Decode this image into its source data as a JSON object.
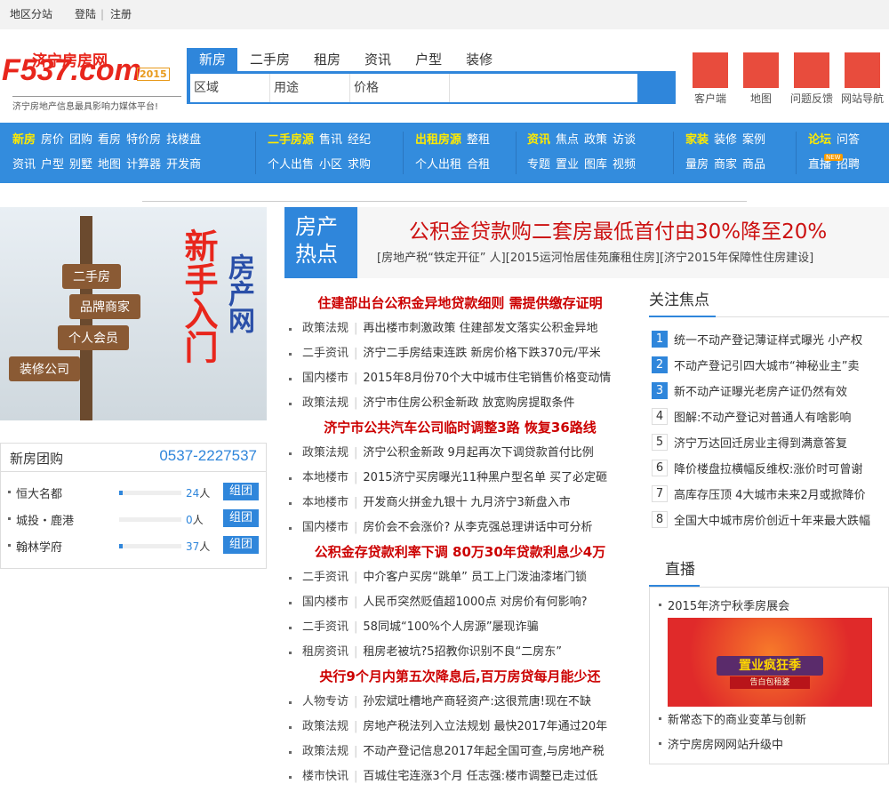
{
  "topbar": {
    "region": "地区分站",
    "login": "登陆",
    "register": "注册"
  },
  "logo": {
    "brand": "F537.com",
    "cn": "济宁房房网",
    "year": "2015",
    "slogan": "济宁房地产信息最具影响力媒体平台!"
  },
  "search": {
    "tabs": [
      "新房",
      "二手房",
      "租房",
      "资讯",
      "户型",
      "装修"
    ],
    "active": 0,
    "filters": [
      "区域",
      "用途",
      "价格"
    ]
  },
  "quick_icons": [
    "客户端",
    "地图",
    "问题反馈",
    "网站导航"
  ],
  "nav": {
    "groups": [
      {
        "rows": [
          [
            "新房",
            "房价",
            "团购",
            "看房",
            "特价房",
            "找楼盘"
          ],
          [
            "资讯",
            "户型",
            "别墅",
            "地图",
            "计算器",
            "开发商"
          ]
        ],
        "hl": [
          [
            0
          ],
          []
        ]
      },
      {
        "rows": [
          [
            "二手房源",
            "售讯",
            "经纪"
          ],
          [
            "个人出售",
            "小区",
            "求购"
          ]
        ],
        "hl": [
          [
            0
          ],
          []
        ]
      },
      {
        "rows": [
          [
            "出租房源",
            "整租"
          ],
          [
            "个人出租",
            "合租"
          ]
        ],
        "hl": [
          [
            0
          ],
          []
        ]
      },
      {
        "rows": [
          [
            "资讯",
            "焦点",
            "政策",
            "访谈"
          ],
          [
            "专题",
            "置业",
            "图库",
            "视频"
          ]
        ],
        "hl": [
          [
            0
          ],
          []
        ]
      },
      {
        "rows": [
          [
            "家装",
            "装修",
            "案例"
          ],
          [
            "量房",
            "商家",
            "商品"
          ]
        ],
        "hl": [
          [
            0
          ],
          []
        ]
      },
      {
        "rows": [
          [
            "论坛",
            "问答"
          ],
          [
            "直播",
            "招聘"
          ]
        ],
        "hl": [
          [
            0
          ],
          []
        ]
      }
    ],
    "new_badge": "NEW"
  },
  "banner": {
    "signs": [
      "二手房",
      "品牌商家",
      "个人会员",
      "装修公司"
    ],
    "title1": "新手入门",
    "title2": "房产网"
  },
  "groupbuy": {
    "title": "新房团购",
    "phone": "0537-2227537",
    "items": [
      {
        "name": "恒大名都",
        "count": "24",
        "unit": "人",
        "progress": 0.03,
        "button": "组团"
      },
      {
        "name": "城投・鹿港",
        "count": "0",
        "unit": "人",
        "progress": 0,
        "button": "组团"
      },
      {
        "name": "翰林学府",
        "count": "37",
        "unit": "人",
        "progress": 0.05,
        "button": "组团"
      }
    ]
  },
  "hot": {
    "label1": "房产",
    "label2": "热点",
    "headline": "公积金贷款购二套房最低首付由30%降至20%",
    "links": "[房地产税“铁定开征” 人][2015运河怡居佳苑廉租住房][济宁2015年保障性住房建设]"
  },
  "news": [
    {
      "headline": "住建部出台公积金异地贷款细则 需提供缴存证明",
      "items": [
        [
          "政策法规",
          "再出楼市刺激政策 住建部发文落实公积金异地"
        ],
        [
          "二手资讯",
          "济宁二手房结束连跌 新房价格下跌370元/平米"
        ],
        [
          "国内楼市",
          "2015年8月份70个大中城市住宅销售价格变动情"
        ],
        [
          "政策法规",
          "济宁市住房公积金新政 放宽购房提取条件"
        ]
      ]
    },
    {
      "headline": "济宁市公共汽车公司临时调整3路 恢复36路线",
      "items": [
        [
          "政策法规",
          "济宁公积金新政 9月起再次下调贷款首付比例"
        ],
        [
          "本地楼市",
          "2015济宁买房曝光11种黑户型名单 买了必定砸"
        ],
        [
          "本地楼市",
          "开发商火拼金九银十 九月济宁3新盘入市"
        ],
        [
          "国内楼市",
          "房价会不会涨价? 从李克强总理讲话中可分析"
        ]
      ]
    },
    {
      "headline": "公积金存贷款利率下调 80万30年贷款利息少4万",
      "items": [
        [
          "二手资讯",
          "中介客户买房“跳单” 员工上门泼油漆堵门锁"
        ],
        [
          "国内楼市",
          "人民币突然贬值超1000点 对房价有何影响?"
        ],
        [
          "二手资讯",
          "58同城“100%个人房源”屡现诈骗"
        ],
        [
          "租房资讯",
          "租房老被坑?5招教你识别不良“二房东”"
        ]
      ]
    },
    {
      "headline": "央行9个月内第五次降息后,百万房贷每月能少还",
      "items": [
        [
          "人物专访",
          "孙宏斌吐槽地产商轻资产:这很荒唐!现在不缺"
        ],
        [
          "政策法规",
          "房地产税法列入立法规划 最快2017年通过20年"
        ],
        [
          "政策法规",
          "不动产登记信息2017年起全国可查,与房地产税"
        ],
        [
          "楼市快讯",
          "百城住宅连涨3个月 任志强:楼市调整已走过低"
        ]
      ]
    }
  ],
  "focus": {
    "title": "关注焦点",
    "items": [
      "统一不动产登记薄证样式曝光 小产权",
      "不动产登记引四大城市“神秘业主”卖",
      "新不动产证曝光老房产证仍然有效",
      "图解:不动产登记对普通人有啥影响",
      "济宁万达回迁房业主得到满意答复",
      "降价楼盘拉横幅反维权:涨价时可曾谢",
      "高库存压顶 4大城市未来2月或掀降价",
      "全国大中城市房价创近十年来最大跌幅"
    ]
  },
  "live": {
    "title": "直播",
    "items": [
      "2015年济宁秋季房展会",
      "新常态下的商业变革与创新",
      "济宁房房网网站升级中"
    ],
    "image_text": "置业疯狂季",
    "image_sub": "告白包租婆"
  },
  "colors": {
    "blue": "#2f86db",
    "red": "#cc0000",
    "yellow": "#ffea00"
  }
}
